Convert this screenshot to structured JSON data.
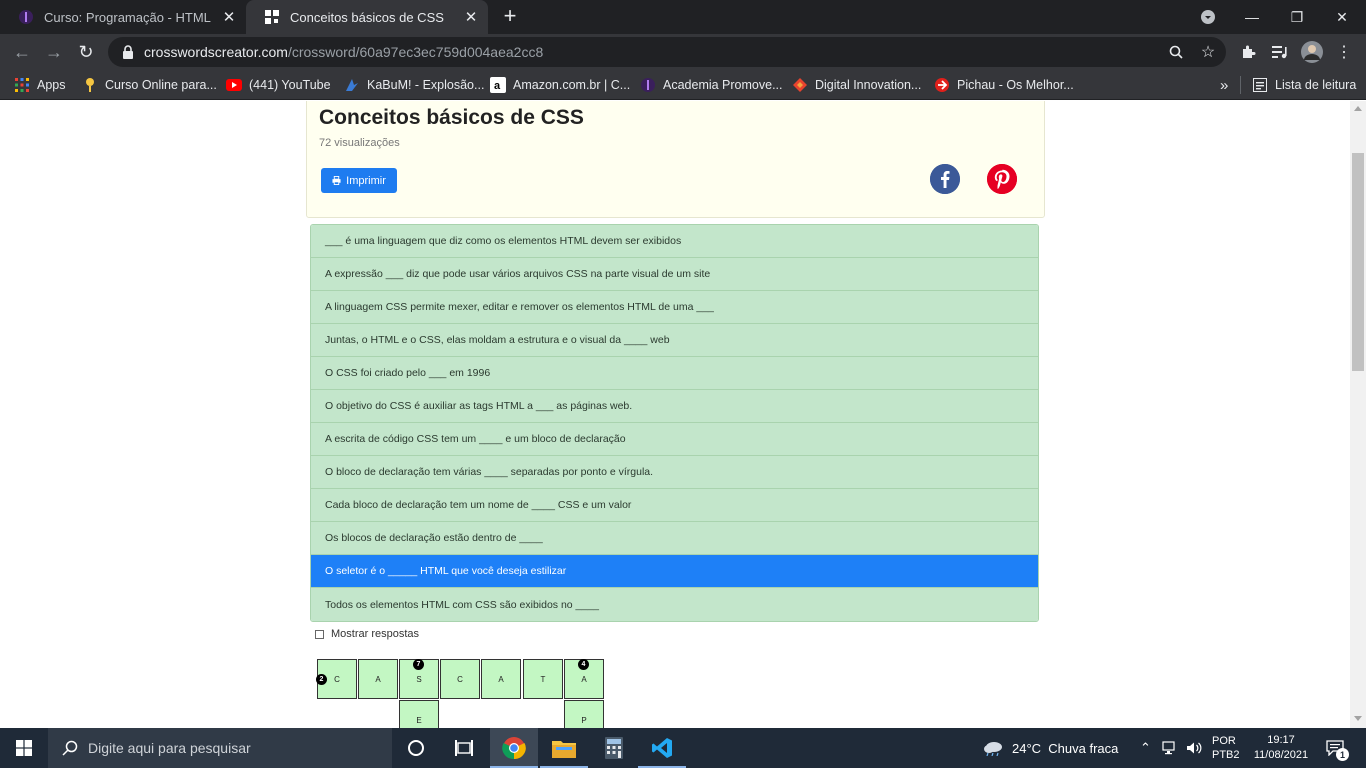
{
  "browser": {
    "tabs": [
      {
        "title": "Curso: Programação - HTML e CSS",
        "active": false
      },
      {
        "title": "Conceitos básicos de CSS",
        "active": true
      }
    ],
    "url": {
      "host": "crosswordscreator.com",
      "path": "/crossword/60a97ec3ec759d004aea2cc8"
    },
    "bookmarks": [
      {
        "label": "Apps",
        "icon": "apps-grid-icon"
      },
      {
        "label": "Curso Online para...",
        "icon": "course-icon"
      },
      {
        "label": "(441) YouTube",
        "icon": "youtube-icon"
      },
      {
        "label": "KaBuM! - Explosão...",
        "icon": "kabum-icon"
      },
      {
        "label": "Amazon.com.br | C...",
        "icon": "amazon-icon"
      },
      {
        "label": "Academia Promove...",
        "icon": "academia-icon"
      },
      {
        "label": "Digital Innovation...",
        "icon": "dio-icon"
      },
      {
        "label": "Pichau - Os Melhor...",
        "icon": "pichau-icon"
      }
    ],
    "overflow_label": "»",
    "reading_list_label": "Lista de leitura",
    "new_tab_label": "+"
  },
  "puzzle": {
    "title": "Conceitos básicos de CSS",
    "views": "72 visualizações",
    "print_label": "Imprimir",
    "show_answers_label": "Mostrar respostas",
    "clues": [
      {
        "text": "___ é uma linguagem que diz como os elementos HTML devem ser exibidos",
        "active": false
      },
      {
        "text": "A expressão ___ diz que pode usar vários arquivos CSS na parte visual de um site",
        "active": false
      },
      {
        "text": "A linguagem CSS permite mexer, editar e remover os elementos HTML de uma ___",
        "active": false
      },
      {
        "text": "Juntas, o HTML e o CSS, elas moldam a estrutura e o visual da ____ web",
        "active": false
      },
      {
        "text": "O CSS foi criado pelo ___ em 1996",
        "active": false
      },
      {
        "text": "O objetivo do CSS é auxiliar as tags HTML a ___ as páginas web.",
        "active": false
      },
      {
        "text": "A escrita de código CSS tem um ____ e um bloco de declaração",
        "active": false
      },
      {
        "text": "O bloco de declaração tem várias ____ separadas por ponto e vírgula.",
        "active": false
      },
      {
        "text": "Cada bloco de declaração tem um nome de ____ CSS e um valor",
        "active": false
      },
      {
        "text": "Os blocos de declaração estão dentro de ____",
        "active": false
      },
      {
        "text": "O seletor é o _____ HTML que você deseja estilizar",
        "active": true
      },
      {
        "text": "Todos os elementos HTML com CSS são exibidos no ____",
        "active": false
      }
    ],
    "grid": {
      "row1": [
        "C",
        "A",
        "S",
        "C",
        "A",
        "T",
        "A"
      ],
      "row2": [
        {
          "col": 2,
          "letter": "E"
        },
        {
          "col": 6,
          "letter": "P"
        }
      ],
      "numbers": [
        {
          "col": 0,
          "row": 0,
          "label": "2",
          "pos": "left"
        },
        {
          "col": 2,
          "row": 0,
          "label": "7",
          "pos": "top"
        },
        {
          "col": 6,
          "row": 0,
          "label": "4",
          "pos": "top"
        }
      ]
    }
  },
  "taskbar": {
    "search_placeholder": "Digite aqui para pesquisar",
    "weather": "24°C  Chuva fraca",
    "language": "POR",
    "layout": "PTB2",
    "time": "19:17",
    "date": "11/08/2021",
    "notifications": "1"
  },
  "colors": {
    "clue_bg": "#c3e6cb",
    "clue_active": "#1e80f7",
    "cell_bg": "#c3f7c3",
    "header_bg": "#fffff0",
    "print_button": "#1e7cf0"
  }
}
